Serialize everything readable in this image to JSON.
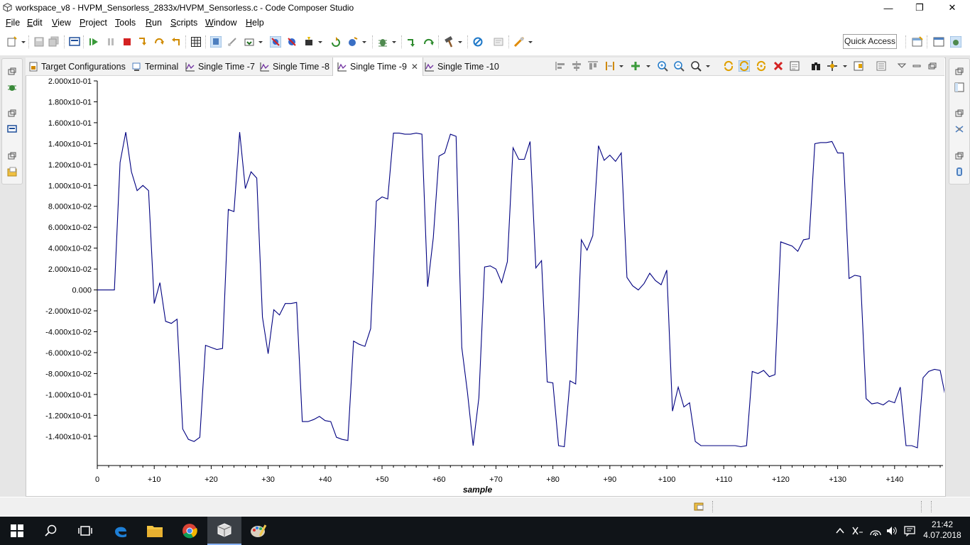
{
  "window": {
    "title": "workspace_v8 - HVPM_Sensorless_2833x/HVPM_Sensorless.c - Code Composer Studio",
    "minimize_glyph": "—",
    "restore_glyph": "❐",
    "close_glyph": "✕"
  },
  "menu": [
    {
      "label": "File",
      "mnemonic": "F",
      "rest": "ile"
    },
    {
      "label": "Edit",
      "mnemonic": "E",
      "rest": "dit"
    },
    {
      "label": "View",
      "mnemonic": "V",
      "rest": "iew"
    },
    {
      "label": "Project",
      "mnemonic": "P",
      "rest": "roject"
    },
    {
      "label": "Tools",
      "mnemonic": "T",
      "rest": "ools"
    },
    {
      "label": "Run",
      "mnemonic": "R",
      "rest": "un"
    },
    {
      "label": "Scripts",
      "mnemonic": "S",
      "rest": "cripts"
    },
    {
      "label": "Window",
      "mnemonic": "W",
      "rest": "indow"
    },
    {
      "label": "Help",
      "mnemonic": "H",
      "rest": "elp"
    }
  ],
  "toolbar": {
    "quick_access": "Quick Access"
  },
  "tabs": [
    {
      "label": "Target Configurations",
      "icon": "target-config-icon",
      "active": false
    },
    {
      "label": "Terminal",
      "icon": "terminal-icon",
      "active": false
    },
    {
      "label": "Single Time -7",
      "icon": "graph-icon",
      "active": false
    },
    {
      "label": "Single Time -8",
      "icon": "graph-icon",
      "active": false
    },
    {
      "label": "Single Time -9",
      "icon": "graph-icon",
      "active": true
    },
    {
      "label": "Single Time -10",
      "icon": "graph-icon",
      "active": false
    }
  ],
  "tab_close_glyph": "✕",
  "chart_data": {
    "type": "line",
    "xlabel": "sample",
    "ylabel": "",
    "ylim": [
      -0.168,
      0.2
    ],
    "xlim": [
      0,
      148.5
    ],
    "grid": false,
    "line_color": "#000080",
    "y_ticks": [
      {
        "v": 0.2,
        "label": "2.000x10-01"
      },
      {
        "v": 0.18,
        "label": "1.800x10-01"
      },
      {
        "v": 0.16,
        "label": "1.600x10-01"
      },
      {
        "v": 0.14,
        "label": "1.400x10-01"
      },
      {
        "v": 0.12,
        "label": "1.200x10-01"
      },
      {
        "v": 0.1,
        "label": "1.000x10-01"
      },
      {
        "v": 0.08,
        "label": "8.000x10-02"
      },
      {
        "v": 0.06,
        "label": "6.000x10-02"
      },
      {
        "v": 0.04,
        "label": "4.000x10-02"
      },
      {
        "v": 0.02,
        "label": "2.000x10-02"
      },
      {
        "v": 0.0,
        "label": "0.000"
      },
      {
        "v": -0.02,
        "label": "-2.000x10-02"
      },
      {
        "v": -0.04,
        "label": "-4.000x10-02"
      },
      {
        "v": -0.06,
        "label": "-6.000x10-02"
      },
      {
        "v": -0.08,
        "label": "-8.000x10-02"
      },
      {
        "v": -0.1,
        "label": "-1.000x10-01"
      },
      {
        "v": -0.12,
        "label": "-1.200x10-01"
      },
      {
        "v": -0.14,
        "label": "-1.400x10-01"
      }
    ],
    "x_ticks": [
      {
        "v": 0,
        "label": "0"
      },
      {
        "v": 10,
        "label": "+10"
      },
      {
        "v": 20,
        "label": "+20"
      },
      {
        "v": 30,
        "label": "+30"
      },
      {
        "v": 40,
        "label": "+40"
      },
      {
        "v": 50,
        "label": "+50"
      },
      {
        "v": 60,
        "label": "+60"
      },
      {
        "v": 70,
        "label": "+70"
      },
      {
        "v": 80,
        "label": "+80"
      },
      {
        "v": 90,
        "label": "+90"
      },
      {
        "v": 100,
        "label": "+100"
      },
      {
        "v": 110,
        "label": "+110"
      },
      {
        "v": 120,
        "label": "+120"
      },
      {
        "v": 130,
        "label": "+130"
      },
      {
        "v": 140,
        "label": "+140"
      }
    ],
    "series": [
      {
        "values": [
          0.0,
          0.0,
          0.0,
          0.0,
          0.122,
          0.151,
          0.113,
          0.095,
          0.1,
          0.095,
          -0.013,
          0.007,
          -0.03,
          -0.032,
          -0.028,
          -0.133,
          -0.143,
          -0.145,
          -0.141,
          -0.053,
          -0.055,
          -0.057,
          -0.056,
          0.077,
          0.075,
          0.151,
          0.097,
          0.113,
          0.107,
          -0.026,
          -0.061,
          -0.019,
          -0.024,
          -0.013,
          -0.013,
          -0.012,
          -0.126,
          -0.126,
          -0.124,
          -0.121,
          -0.125,
          -0.126,
          -0.141,
          -0.143,
          -0.144,
          -0.049,
          -0.052,
          -0.054,
          -0.037,
          0.085,
          0.089,
          0.087,
          0.15,
          0.15,
          0.149,
          0.149,
          0.15,
          0.149,
          0.003,
          0.05,
          0.128,
          0.131,
          0.149,
          0.147,
          -0.055,
          -0.098,
          -0.149,
          -0.103,
          0.022,
          0.023,
          0.02,
          0.007,
          0.027,
          0.136,
          0.125,
          0.125,
          0.142,
          0.021,
          0.028,
          -0.088,
          -0.089,
          -0.149,
          -0.15,
          -0.087,
          -0.09,
          0.048,
          0.038,
          0.052,
          0.138,
          0.124,
          0.129,
          0.123,
          0.131,
          0.012,
          0.004,
          0.0,
          0.006,
          0.016,
          0.009,
          0.005,
          0.019,
          -0.116,
          -0.093,
          -0.112,
          -0.108,
          -0.145,
          -0.149,
          -0.149,
          -0.149,
          -0.149,
          -0.149,
          -0.149,
          -0.149,
          -0.15,
          -0.149,
          -0.078,
          -0.08,
          -0.077,
          -0.083,
          -0.081,
          0.046,
          0.044,
          0.042,
          0.037,
          0.048,
          0.049,
          0.14,
          0.141,
          0.141,
          0.142,
          0.131,
          0.131,
          0.011,
          0.014,
          0.013,
          -0.104,
          -0.109,
          -0.108,
          -0.11,
          -0.106,
          -0.108,
          -0.093,
          -0.149,
          -0.149,
          -0.151,
          -0.084,
          -0.078,
          -0.076,
          -0.077,
          -0.104
        ]
      }
    ]
  },
  "taskbar": {
    "time": "21:42",
    "date": "4.07.2018"
  }
}
